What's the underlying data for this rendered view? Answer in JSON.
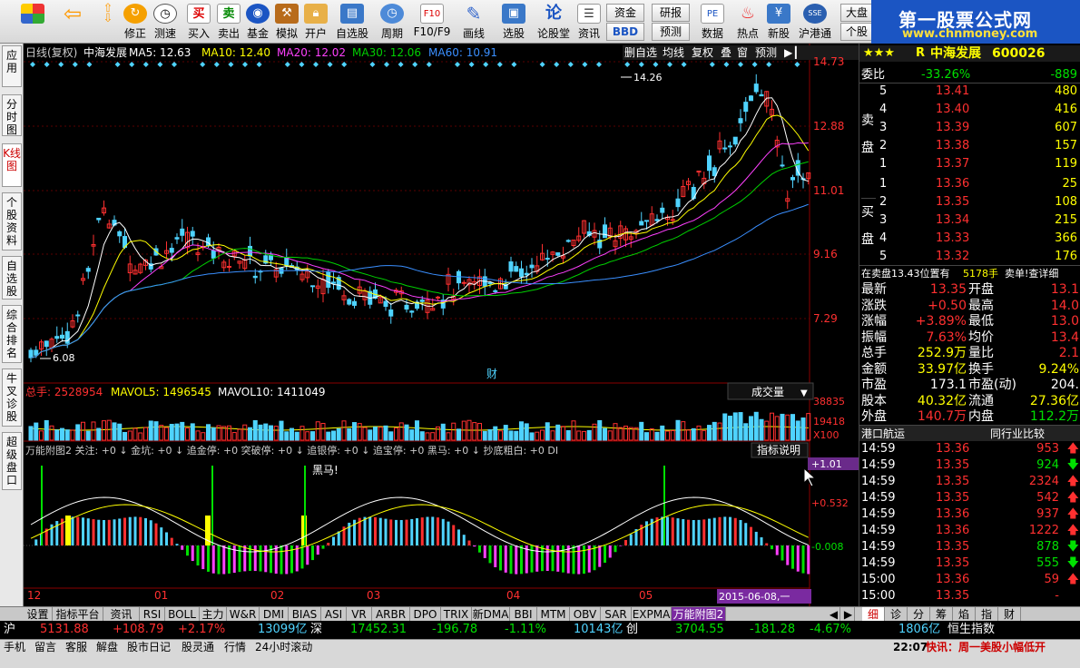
{
  "toolbar": {
    "items": [
      "",
      "",
      "修正",
      "测速",
      "买入",
      "卖出",
      "基金",
      "模拟",
      "开户",
      "自选股",
      "周期",
      "F10/F9",
      "画线",
      "选股",
      "论股堂",
      "资讯",
      "",
      "",
      "数据",
      "热点",
      "新股",
      "沪港通"
    ],
    "fund_label": "资金",
    "bbd_label": "BBD",
    "research_label": "研报",
    "forecast_label": "预测",
    "market_label": "大盘",
    "stock_label": "个股"
  },
  "logo": {
    "title": "第一股票公式网",
    "url": "www.chnmoney.com"
  },
  "left_tabs": [
    "应用",
    "分时图",
    "K线图",
    "个股资料",
    "自选股",
    "综合排名",
    "牛叉诊股",
    "超级盘口"
  ],
  "chart": {
    "info": {
      "period": "日线(复权)",
      "name": "中海发展",
      "ma5": "MA5: 12.63",
      "ma10": "MA10: 12.40",
      "ma20": "MA20: 12.02",
      "ma30": "MA30: 12.06",
      "ma60": "MA60: 10.91"
    },
    "buttons": [
      "删自选",
      "均线",
      "复权",
      "叠",
      "窗",
      "预测"
    ],
    "price_ticks": [
      "14.73",
      "12.88",
      "11.01",
      "9.16",
      "7.29"
    ],
    "high_label": "14.26",
    "low_label": "6.08",
    "cai_label": "财",
    "vol_info": {
      "total": "总手: 2528954",
      "mavol5": "MAVOL5: 1496545",
      "mavol10": "MAVOL10: 1411049"
    },
    "vol_dropdown": "成交量",
    "vol_ticks": [
      "38835",
      "19418",
      "X100"
    ],
    "ind_info": "万能附图2 关注: +0 ↓ 金坑: +0 ↓ 追金停: +0 突破停: +0 ↓ 追银停: +0 ↓ 追宝停: +0 黑马: +0 ↓ 抄底粗白: +0 DI",
    "ind_button": "指标说明",
    "ind_ticks": [
      "+1.01",
      "+0.532",
      "-0.008"
    ],
    "heima_label": "黑马!",
    "months": [
      "12",
      "01",
      "02",
      "03",
      "04",
      "05"
    ],
    "date_label": "2015-06-08,一",
    "colors": {
      "up": "#ff3030",
      "down": "#4fd3ff",
      "ma5": "#ffffff",
      "ma10": "#ffff00",
      "ma20": "#ff40ff",
      "ma30": "#00d000",
      "ma60": "#3a8fff",
      "bg": "#000000"
    }
  },
  "chart_data": {
    "type": "candlestick",
    "ylim": [
      6.08,
      14.73
    ],
    "high": 14.26,
    "low": 6.08,
    "months": [
      "12",
      "01",
      "02",
      "03",
      "04",
      "05"
    ]
  },
  "quote": {
    "stars": "★★★",
    "prefix": "R",
    "name": "中海发展",
    "code": "600026",
    "wei_bi": "委比",
    "wei_bi_val": "-33.26%",
    "wei_cha": "-889",
    "sell_label": "卖盘",
    "buy_label": "买盘",
    "asks": [
      [
        "5",
        "13.41",
        "480"
      ],
      [
        "4",
        "13.40",
        "416"
      ],
      [
        "3",
        "13.39",
        "607"
      ],
      [
        "2",
        "13.38",
        "157"
      ],
      [
        "1",
        "13.37",
        "119"
      ]
    ],
    "bids": [
      [
        "1",
        "13.36",
        "25"
      ],
      [
        "2",
        "13.35",
        "108"
      ],
      [
        "3",
        "13.34",
        "215"
      ],
      [
        "4",
        "13.33",
        "366"
      ],
      [
        "5",
        "13.32",
        "176"
      ]
    ],
    "notice": "在卖盘13.43位置有",
    "notice_vol": "5178手",
    "notice_tail": "卖单!查详细",
    "stats": [
      [
        "最新",
        "13.35",
        "开盘",
        "13.1"
      ],
      [
        "涨跌",
        "+0.50",
        "最高",
        "14.0"
      ],
      [
        "涨幅",
        "+3.89%",
        "最低",
        "13.0"
      ],
      [
        "振幅",
        "7.63%",
        "均价",
        "13.4"
      ],
      [
        "总手",
        "252.9万",
        "量比",
        "2.1"
      ],
      [
        "金额",
        "33.97亿",
        "换手",
        "9.24%"
      ],
      [
        "市盈",
        "173.1",
        "市盈(动)",
        "204."
      ],
      [
        "股本",
        "40.32亿",
        "流通",
        "27.36亿"
      ],
      [
        "外盘",
        "140.7万",
        "内盘",
        "112.2万"
      ]
    ],
    "sector": "港口航运",
    "compare": "同行业比较",
    "ticks": [
      [
        "14:59",
        "13.36",
        "953"
      ],
      [
        "14:59",
        "13.35",
        "924"
      ],
      [
        "14:59",
        "13.35",
        "2324"
      ],
      [
        "14:59",
        "13.35",
        "542"
      ],
      [
        "14:59",
        "13.36",
        "937"
      ],
      [
        "14:59",
        "13.36",
        "1222"
      ],
      [
        "14:59",
        "13.35",
        "878"
      ],
      [
        "14:59",
        "13.35",
        "555"
      ],
      [
        "15:00",
        "13.36",
        "59"
      ],
      [
        "15:00",
        "13.35",
        "-"
      ]
    ]
  },
  "bottom_tabs": [
    "设置",
    "指标平台",
    "资讯",
    "RSI",
    "BOLL",
    "主力",
    "W&R",
    "DMI",
    "BIAS",
    "ASI",
    "VR",
    "ARBR",
    "DPO",
    "TRIX",
    "新DMA",
    "BBI",
    "MTM",
    "OBV",
    "SAR",
    "EXPMA",
    "万能附图2"
  ],
  "right_tabs": [
    "细",
    "诊",
    "分",
    "筹",
    "焰",
    "指",
    "财"
  ],
  "index_bar": {
    "sh": "沪",
    "sh_val": "5131.88",
    "sh_chg": "+108.79",
    "sh_pct": "+2.17%",
    "sh_amt": "13099亿",
    "sz": "深",
    "sz_val": "17452.31",
    "sz_chg": "-196.78",
    "sz_pct": "-1.11%",
    "sz_amt": "10143亿",
    "cy": "创",
    "cy_val": "3704.55",
    "cy_chg": "-181.28",
    "cy_pct": "-4.67%",
    "cy_amt": "1806亿",
    "hs": "恒生指数"
  },
  "status": {
    "items": [
      "手机",
      "留言",
      "客服",
      "解盘",
      "股市日记",
      "股灵通",
      "行情",
      "24小时滚动"
    ],
    "time": "22:07",
    "news": "快讯：周一美股小幅低开"
  }
}
